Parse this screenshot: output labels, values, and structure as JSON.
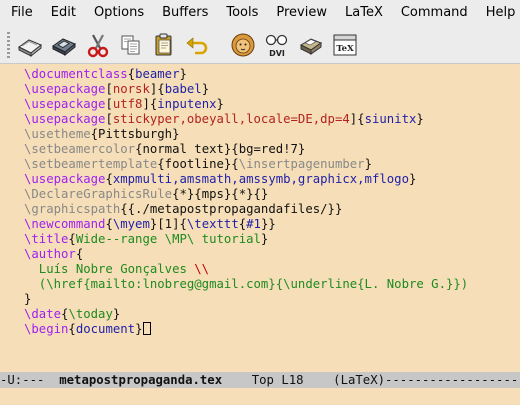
{
  "menubar": {
    "items": [
      "File",
      "Edit",
      "Options",
      "Buffers",
      "Tools",
      "Preview",
      "LaTeX",
      "Command",
      "Help"
    ]
  },
  "toolbar": {
    "dvi_label": "DVI",
    "tex_label": "TeX",
    "buttons": [
      "open-file",
      "save-file",
      "cut",
      "copy",
      "paste",
      "undo",
      "run-latex",
      "view-dvi",
      "print",
      "run-tex"
    ]
  },
  "colors": {
    "editor_bg": "#f6dfb8",
    "command": "#a020f0",
    "control": "#888888",
    "argument": "#1f1fa8",
    "option": "#b22222",
    "string": "#1f8a1f",
    "modeline_bg": "#c7c7c7"
  },
  "buffer": {
    "lines": [
      [
        {
          "t": "\\documentclass",
          "c": "cmd"
        },
        {
          "t": "{",
          "c": "blk"
        },
        {
          "t": "beamer",
          "c": "arg"
        },
        {
          "t": "}",
          "c": "blk"
        }
      ],
      [
        {
          "t": "\\usepackage",
          "c": "cmd"
        },
        {
          "t": "[",
          "c": "blk"
        },
        {
          "t": "norsk",
          "c": "opt"
        },
        {
          "t": "]{",
          "c": "blk"
        },
        {
          "t": "babel",
          "c": "arg"
        },
        {
          "t": "}",
          "c": "blk"
        }
      ],
      [
        {
          "t": "\\usepackage",
          "c": "cmd"
        },
        {
          "t": "[",
          "c": "blk"
        },
        {
          "t": "utf8",
          "c": "opt"
        },
        {
          "t": "]{",
          "c": "blk"
        },
        {
          "t": "inputenx",
          "c": "arg"
        },
        {
          "t": "}",
          "c": "blk"
        }
      ],
      [
        {
          "t": "\\usepackage",
          "c": "cmd"
        },
        {
          "t": "[",
          "c": "blk"
        },
        {
          "t": "stickyper,obeyall,locale=DE,dp=4",
          "c": "opt"
        },
        {
          "t": "]{",
          "c": "blk"
        },
        {
          "t": "siunitx",
          "c": "arg"
        },
        {
          "t": "}",
          "c": "blk"
        }
      ],
      [
        {
          "t": "\\usetheme",
          "c": "ctl"
        },
        {
          "t": "{Pittsburgh}",
          "c": "blk"
        }
      ],
      [
        {
          "t": "\\setbeamercolor",
          "c": "ctl"
        },
        {
          "t": "{normal text}{bg=red!7}",
          "c": "blk"
        }
      ],
      [
        {
          "t": "\\setbeamertemplate",
          "c": "ctl"
        },
        {
          "t": "{footline}{",
          "c": "blk"
        },
        {
          "t": "\\insertpagenumber",
          "c": "ctl"
        },
        {
          "t": "}",
          "c": "blk"
        }
      ],
      [
        {
          "t": "\\usepackage",
          "c": "cmd"
        },
        {
          "t": "{",
          "c": "blk"
        },
        {
          "t": "xmpmulti,amsmath,amssymb,graphicx,mflogo",
          "c": "arg"
        },
        {
          "t": "}",
          "c": "blk"
        }
      ],
      [
        {
          "t": "\\DeclareGraphicsRule",
          "c": "ctl"
        },
        {
          "t": "{*}{mps}{*}{}",
          "c": "blk"
        }
      ],
      [
        {
          "t": "\\graphicspath",
          "c": "ctl"
        },
        {
          "t": "{{./metapostpropagandafiles/}}",
          "c": "blk"
        }
      ],
      [
        {
          "t": "\\newcommand",
          "c": "cmd"
        },
        {
          "t": "{",
          "c": "blk"
        },
        {
          "t": "\\myem",
          "c": "arg"
        },
        {
          "t": "}[1]{",
          "c": "blk"
        },
        {
          "t": "\\texttt",
          "c": "arg"
        },
        {
          "t": "{",
          "c": "blk"
        },
        {
          "t": "#1",
          "c": "arg"
        },
        {
          "t": "}}",
          "c": "blk"
        }
      ],
      [
        {
          "t": "\\title",
          "c": "cmd"
        },
        {
          "t": "{",
          "c": "blk"
        },
        {
          "t": "Wide--range \\MP\\ tutorial",
          "c": "grn"
        },
        {
          "t": "}",
          "c": "blk"
        }
      ],
      [
        {
          "t": "\\author",
          "c": "cmd"
        },
        {
          "t": "{",
          "c": "blk"
        }
      ],
      [
        {
          "t": "  Luís Nobre Gonçalves ",
          "c": "grn"
        },
        {
          "t": "\\\\",
          "c": "red"
        }
      ],
      [
        {
          "t": "  (\\href{mailto:lnobreg@gmail.com}{\\underline{L. Nobre G.}})",
          "c": "grn"
        }
      ],
      [
        {
          "t": "}",
          "c": "blk"
        }
      ],
      [
        {
          "t": "\\date",
          "c": "cmd"
        },
        {
          "t": "{",
          "c": "blk"
        },
        {
          "t": "\\today",
          "c": "grn"
        },
        {
          "t": "}",
          "c": "blk"
        }
      ],
      [
        {
          "t": "\\begin",
          "c": "cmd"
        },
        {
          "t": "{",
          "c": "blk"
        },
        {
          "t": "document",
          "c": "arg"
        },
        {
          "t": "}",
          "c": "blk"
        }
      ]
    ]
  },
  "modeline": {
    "status": "-U:---  ",
    "buffer_name": "metapostpropaganda.tex",
    "position": "    Top L18    ",
    "mode": "(LaTeX)------------------------"
  }
}
